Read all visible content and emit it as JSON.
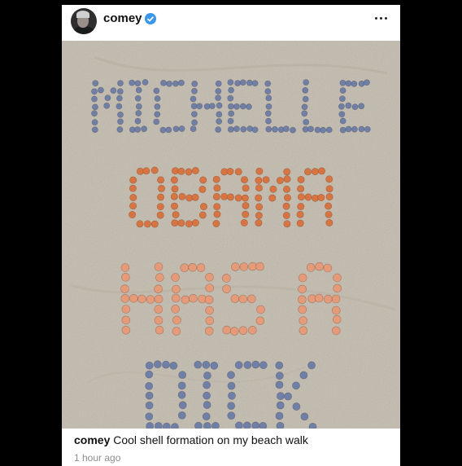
{
  "post": {
    "username": "comey",
    "verified": true,
    "menu_icon": "more-horizontal-icon",
    "photo_text_lines": [
      "MICHELLE",
      "OBAMA",
      "HAS A",
      "DICK"
    ],
    "caption_user": "comey",
    "caption_text": "Cool shell formation on my beach walk",
    "timestamp": "1 hour ago"
  },
  "colors": {
    "background": "#000000",
    "card": "#ffffff",
    "verified_badge": "#3897f0",
    "sand": "#c9c3b6",
    "shell_blue": "#6e7fa8",
    "shell_orange": "#d9733f",
    "shell_peach": "#e79a77"
  }
}
